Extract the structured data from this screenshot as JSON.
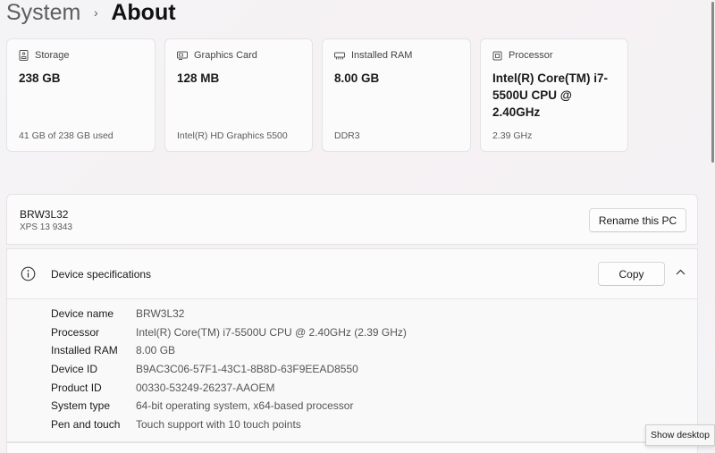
{
  "breadcrumb": {
    "parent": "System",
    "separator": "›",
    "current": "About"
  },
  "cards": [
    {
      "title": "Storage",
      "icon": "storage-icon",
      "value": "238 GB",
      "sub": "41 GB of 238 GB used"
    },
    {
      "title": "Graphics Card",
      "icon": "graphics-card-icon",
      "value": "128 MB",
      "sub": "Intel(R) HD Graphics 5500"
    },
    {
      "title": "Installed RAM",
      "icon": "ram-icon",
      "value": "8.00 GB",
      "sub": "DDR3"
    },
    {
      "title": "Processor",
      "icon": "processor-icon",
      "value": "Intel(R) Core(TM) i7-5500U CPU @ 2.40GHz",
      "sub": "2.39 GHz"
    }
  ],
  "pc": {
    "name": "BRW3L32",
    "model": "XPS 13 9343",
    "rename_label": "Rename this PC"
  },
  "specs": {
    "title": "Device specifications",
    "icon": "info-icon",
    "copy_label": "Copy",
    "collapse_icon": "chevron-up-icon",
    "rows": [
      {
        "label": "Device name",
        "value": "BRW3L32"
      },
      {
        "label": "Processor",
        "value": "Intel(R) Core(TM) i7-5500U CPU @ 2.40GHz (2.39 GHz)"
      },
      {
        "label": "Installed RAM",
        "value": "8.00 GB"
      },
      {
        "label": "Device ID",
        "value": "B9AC3C06-57F1-43C1-8B8D-63F9EEAD8550"
      },
      {
        "label": "Product ID",
        "value": "00330-53249-26237-AAOEM"
      },
      {
        "label": "System type",
        "value": "64-bit operating system, x64-based processor"
      },
      {
        "label": "Pen and touch",
        "value": "Touch support with 10 touch points"
      }
    ]
  },
  "tooltip": "Show desktop"
}
